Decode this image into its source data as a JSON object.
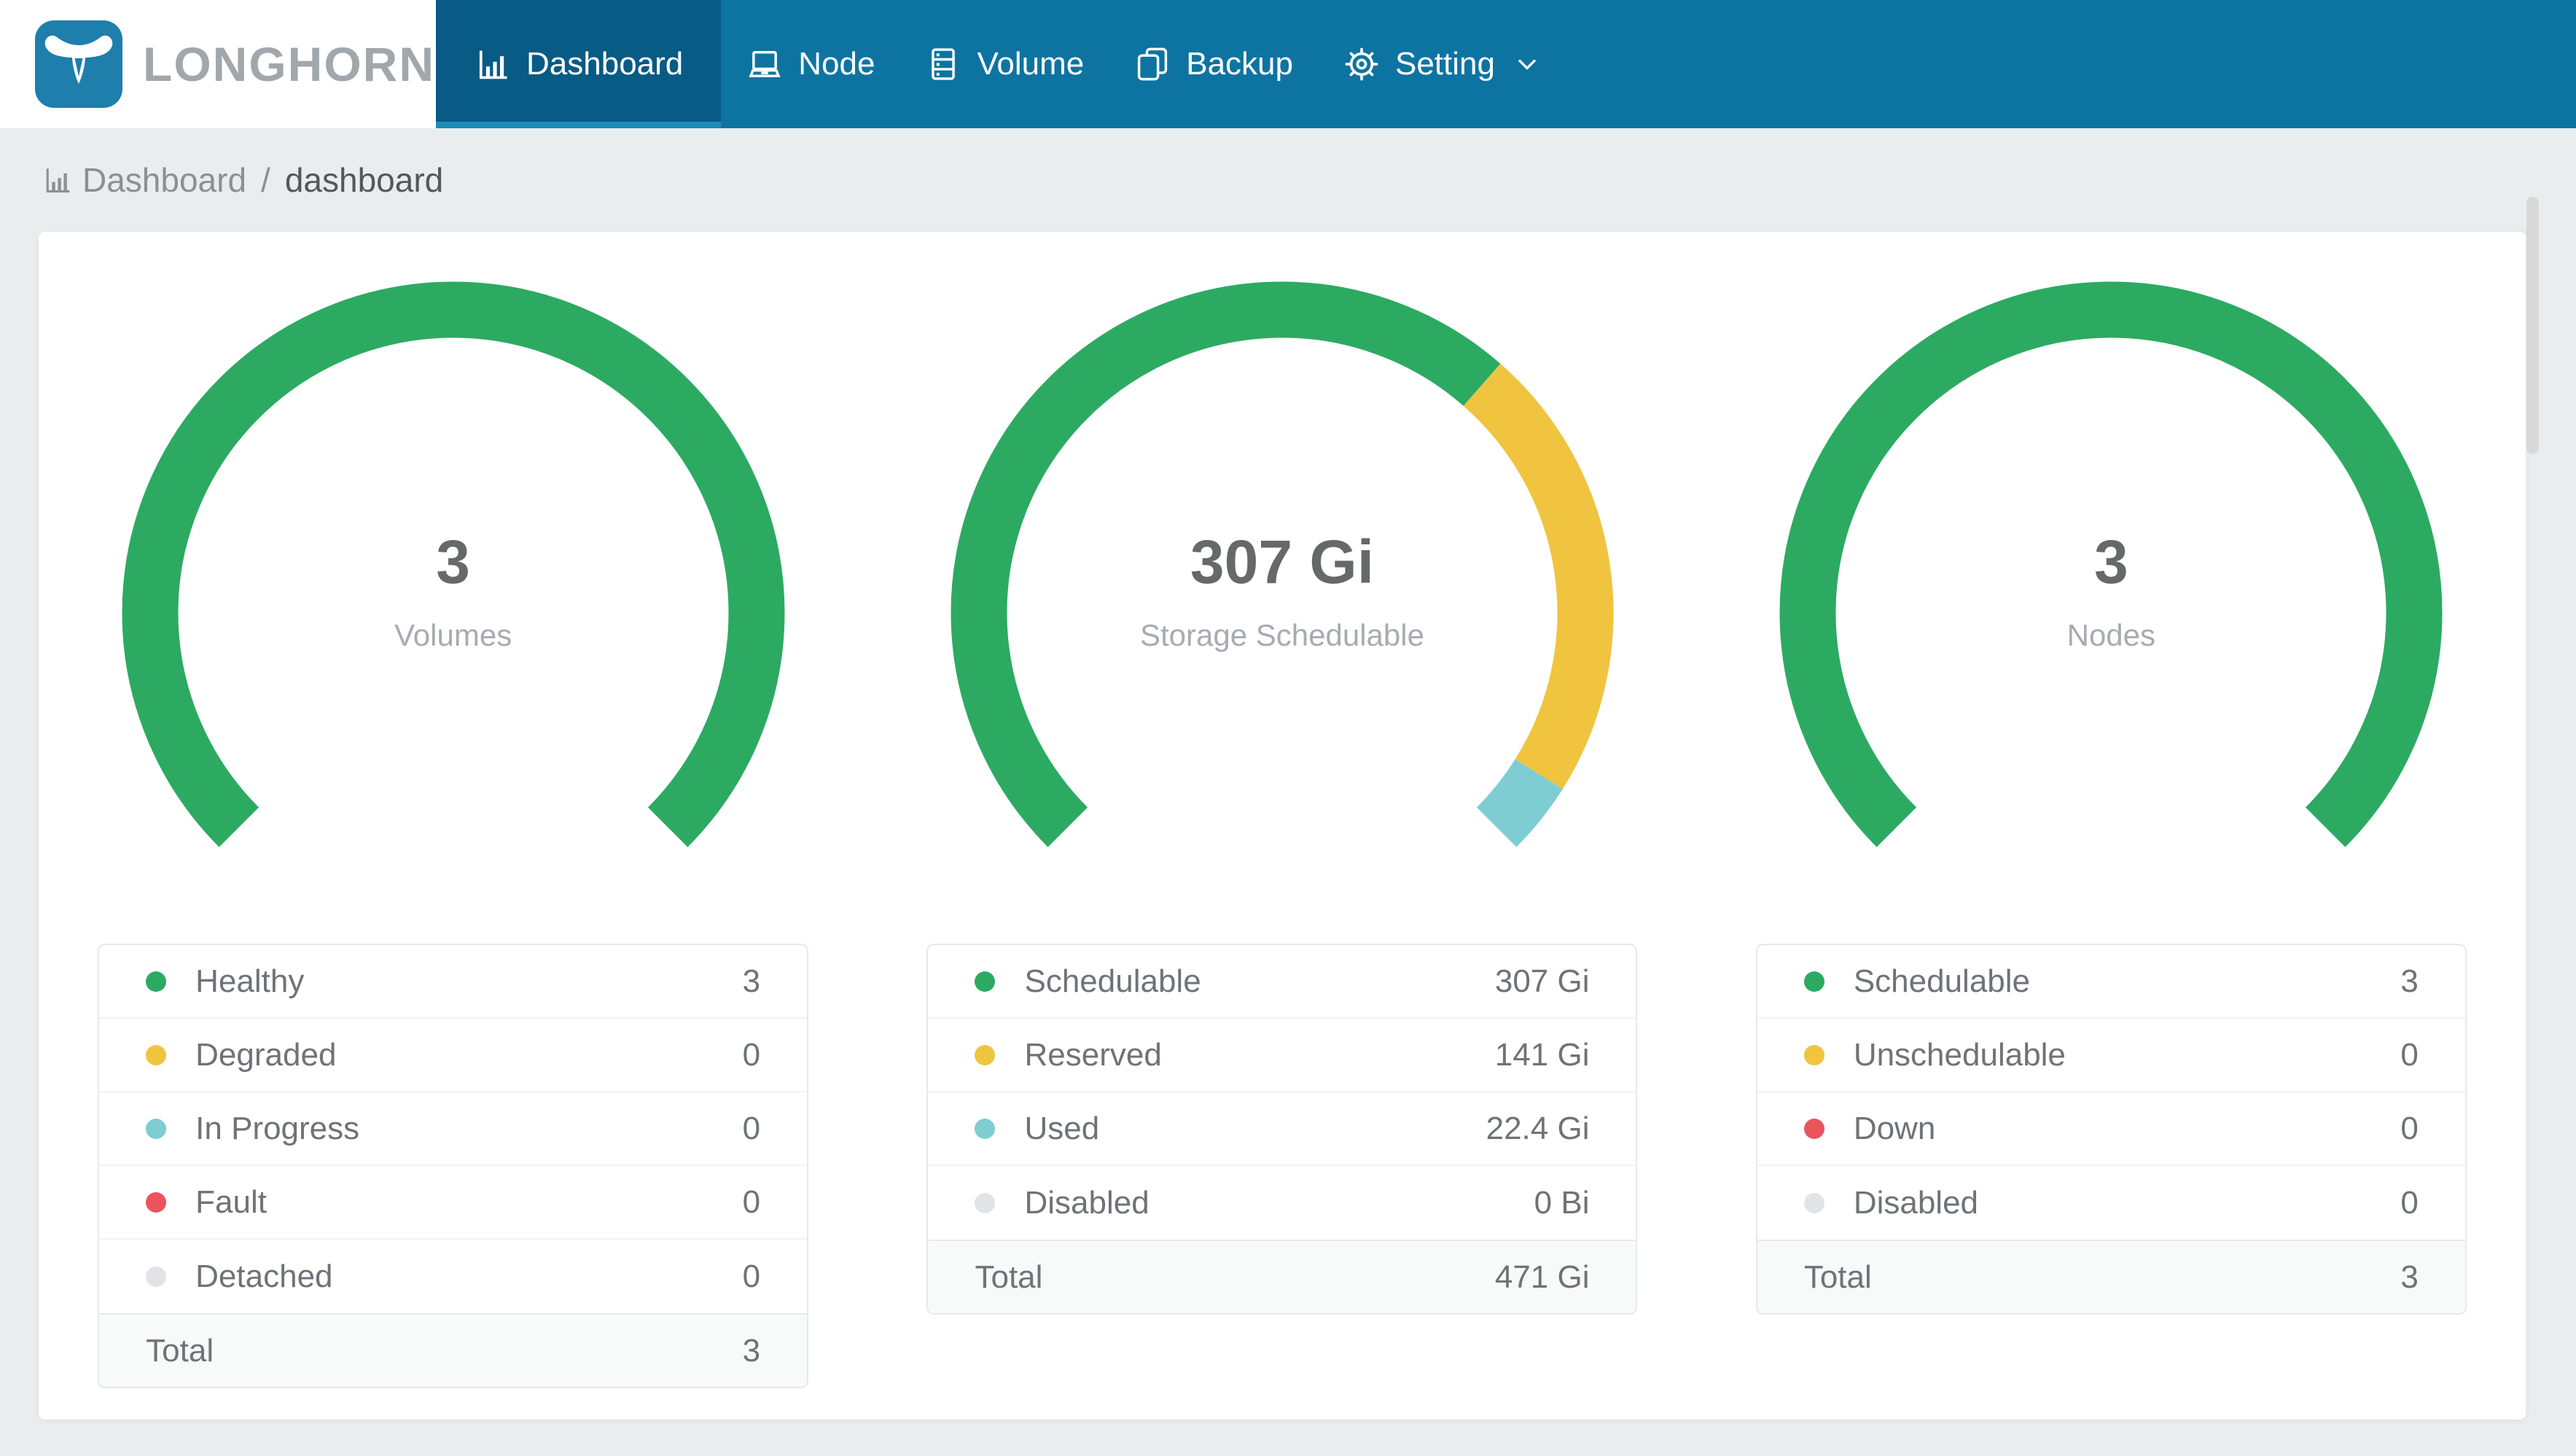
{
  "app": {
    "brand": "LONGHORN"
  },
  "theme": {
    "navbar_bg": "#0d74a2",
    "navbar_active_bg": "#085b85",
    "navbar_active_underline": "#1e8cb8",
    "logo_blue": "#1e7eac",
    "page_bg": "#e9edee",
    "green": "#2caa62",
    "yellow": "#f0c43e",
    "teal": "#7ecdd3",
    "red": "#e9545d",
    "gray": "#e1e4e7"
  },
  "navbar": {
    "items": [
      {
        "label": "Dashboard",
        "icon": "bar-chart-icon",
        "active": true
      },
      {
        "label": "Node",
        "icon": "laptop-icon",
        "active": false
      },
      {
        "label": "Volume",
        "icon": "storage-stack-icon",
        "active": false
      },
      {
        "label": "Backup",
        "icon": "copy-icon",
        "active": false
      },
      {
        "label": "Setting",
        "icon": "gear-icon",
        "active": false,
        "has_chevron": true
      }
    ]
  },
  "breadcrumb": {
    "section": "Dashboard",
    "separator": "/",
    "current": "dashboard"
  },
  "chart_data": [
    {
      "type": "donut-gauge",
      "title": "Volumes",
      "center_value": "3",
      "center_label": "Volumes",
      "start_angle": 225,
      "span_degrees": 270,
      "segments": [
        {
          "name": "Healthy",
          "value": 3,
          "display": "3",
          "color": "#2caa62"
        },
        {
          "name": "Degraded",
          "value": 0,
          "display": "0",
          "color": "#f0c43e"
        },
        {
          "name": "In Progress",
          "value": 0,
          "display": "0",
          "color": "#7ecdd3"
        },
        {
          "name": "Fault",
          "value": 0,
          "display": "0",
          "color": "#e9545d"
        },
        {
          "name": "Detached",
          "value": 0,
          "display": "0",
          "color": "#e1e4e7"
        }
      ],
      "total_label": "Total",
      "total_display": "3"
    },
    {
      "type": "donut-gauge",
      "title": "Storage Schedulable",
      "center_value": "307 Gi",
      "center_label": "Storage Schedulable",
      "start_angle": 225,
      "span_degrees": 270,
      "segments": [
        {
          "name": "Schedulable",
          "value": 307,
          "display": "307 Gi",
          "color": "#2caa62"
        },
        {
          "name": "Reserved",
          "value": 141,
          "display": "141 Gi",
          "color": "#f0c43e"
        },
        {
          "name": "Used",
          "value": 22.4,
          "display": "22.4 Gi",
          "color": "#7ecdd3"
        },
        {
          "name": "Disabled",
          "value": 0,
          "display": "0 Bi",
          "color": "#e1e4e7"
        }
      ],
      "total_label": "Total",
      "total_display": "471 Gi"
    },
    {
      "type": "donut-gauge",
      "title": "Nodes",
      "center_value": "3",
      "center_label": "Nodes",
      "start_angle": 225,
      "span_degrees": 270,
      "segments": [
        {
          "name": "Schedulable",
          "value": 3,
          "display": "3",
          "color": "#2caa62"
        },
        {
          "name": "Unschedulable",
          "value": 0,
          "display": "0",
          "color": "#f0c43e"
        },
        {
          "name": "Down",
          "value": 0,
          "display": "0",
          "color": "#e9545d"
        },
        {
          "name": "Disabled",
          "value": 0,
          "display": "0",
          "color": "#e1e4e7"
        }
      ],
      "total_label": "Total",
      "total_display": "3"
    }
  ]
}
